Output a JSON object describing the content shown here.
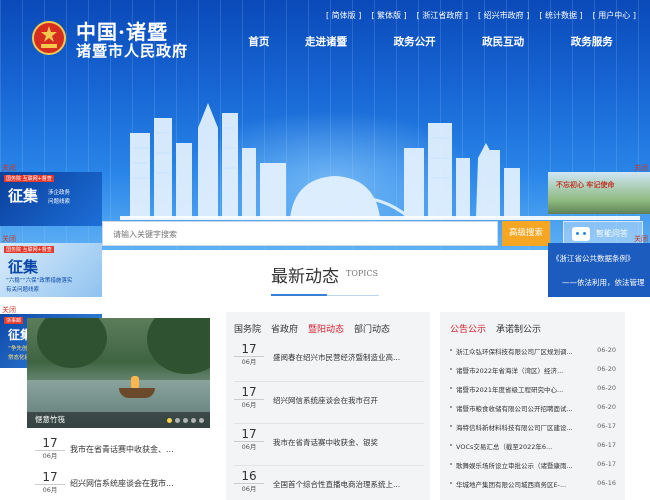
{
  "header": {
    "logo_title": "中国·诸暨",
    "logo_subtitle": "诸暨市人民政府",
    "top_links": [
      "[ 简体版 ]",
      "[ 繁体版 ]",
      "[ 浙江省政府 ]",
      "[ 绍兴市政府 ]",
      "[ 统计数据 ]",
      "[ 用户中心 ]"
    ],
    "nav": [
      "首页",
      "走进诸暨",
      "政务公开",
      "政民互动",
      "政务服务"
    ]
  },
  "search": {
    "placeholder": "请输入关键字搜索",
    "button": "高级搜索",
    "smart_button": "智能问答"
  },
  "ads": {
    "close": "关闭",
    "ad1": {
      "title": "征集",
      "lines": [
        "涉企政务",
        "问题线索"
      ],
      "tag": "国务院 互联网+督查"
    },
    "ad2": {
      "title": "征集",
      "lines": [
        "“六稳”“六保”政策措施落实",
        "有关问题线索"
      ],
      "tag": "国务院 互联网+督查"
    },
    "ad3": {
      "title": "征集",
      "lines": [
        "“争先创优行动”和",
        "常态化疫情防控政策措施落实"
      ],
      "tag": "浙事邮"
    },
    "ad4": {
      "title": "不忘初心 牢记使命"
    },
    "ad5": {
      "title": "《浙江省公共数据条例》",
      "sub": "——依法利用，依法管理"
    }
  },
  "section": {
    "title": "最新动态",
    "title_en": "TOPICS"
  },
  "photo": {
    "caption": "惬意竹筏"
  },
  "left_news": [
    {
      "day": "17",
      "month": "06月",
      "title": "我市在省青话赛中收获金、..."
    },
    {
      "day": "17",
      "month": "06月",
      "title": "绍兴网信系统座谈会在我市..."
    }
  ],
  "mid": {
    "tabs": [
      "国务院",
      "省政府",
      "暨阳动态",
      "部门动态"
    ],
    "active_tab": 2,
    "news": [
      {
        "day": "17",
        "month": "06月",
        "title": "盛阅春在绍兴市民营经济暨制造业高..."
      },
      {
        "day": "17",
        "month": "06月",
        "title": "绍兴网信系统座谈会在我市召开"
      },
      {
        "day": "17",
        "month": "06月",
        "title": "我市在省青话赛中收获金、银奖"
      },
      {
        "day": "16",
        "month": "06月",
        "title": "全国首个综合性直播电商治理系统上..."
      }
    ]
  },
  "right": {
    "tabs": [
      "公告公示",
      "承诺制公示"
    ],
    "active_tab": 0,
    "items": [
      {
        "title": "浙江众弘环保科技有限公司厂区规划调...",
        "date": "06-20"
      },
      {
        "title": "诸暨市2022年省海洋（湾区）经济...",
        "date": "06-20"
      },
      {
        "title": "诸暨市2021年度省级工程研究中心...",
        "date": "06-20"
      },
      {
        "title": "诸暨市粮食收储有限公司公开招聘面试...",
        "date": "06-20"
      },
      {
        "title": "海特信科新材料科技有限公司厂区建设...",
        "date": "06-17"
      },
      {
        "title": "VOCs交易汇总（截至2022年6...",
        "date": "06-17"
      },
      {
        "title": "歌舞娱乐场所设立审批公示（诸暨康雨...",
        "date": "06-17"
      },
      {
        "title": "华城地产集团有限公司城西商务区E-...",
        "date": "06-16"
      }
    ]
  }
}
